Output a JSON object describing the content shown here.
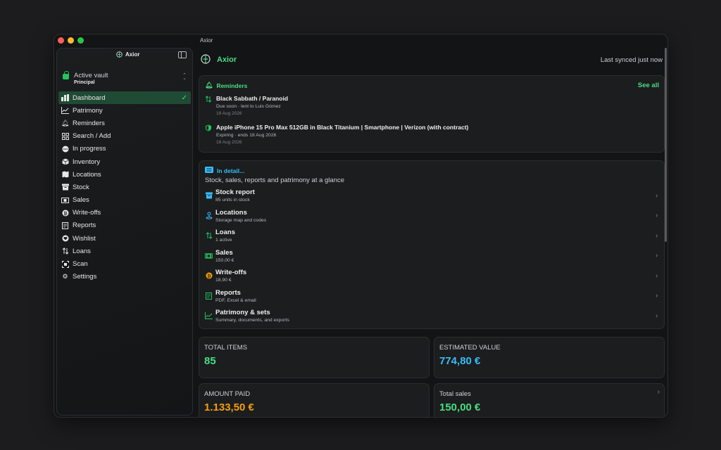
{
  "window": {
    "title": "Axior"
  },
  "sidebar": {
    "brand": "Axior",
    "vault_label": "Active vault",
    "vault_name": "Principal",
    "items": [
      {
        "label": "Dashboard",
        "icon": "bar-chart-icon",
        "active": true
      },
      {
        "label": "Patrimony",
        "icon": "line-chart-icon"
      },
      {
        "label": "Reminders",
        "icon": "bell-icon"
      },
      {
        "label": "Search / Add",
        "icon": "grid-icon"
      },
      {
        "label": "In progress",
        "icon": "ellipsis-circle-icon"
      },
      {
        "label": "Inventory",
        "icon": "cube-icon"
      },
      {
        "label": "Locations",
        "icon": "map-icon"
      },
      {
        "label": "Stock",
        "icon": "archive-box-icon"
      },
      {
        "label": "Sales",
        "icon": "banknote-icon"
      },
      {
        "label": "Write-offs",
        "icon": "coin-icon"
      },
      {
        "label": "Reports",
        "icon": "document-icon"
      },
      {
        "label": "Wishlist",
        "icon": "heart-icon"
      },
      {
        "label": "Loans",
        "icon": "arrows-icon"
      },
      {
        "label": "Scan",
        "icon": "scan-icon"
      },
      {
        "label": "Settings",
        "icon": "gear-icon"
      }
    ]
  },
  "header": {
    "title": "Axior",
    "sync_status": "Last synced just now"
  },
  "reminders": {
    "heading": "Reminders",
    "see_all": "See all",
    "items": [
      {
        "title": "Black Sabbath / Paranoid",
        "subtitle": "Due soon · lent to Luis Gómez",
        "date": "18 Aug 2026",
        "icon": "loan-arrows-icon"
      },
      {
        "title": "Apple iPhone 15 Pro Max 512GB in Black Titanium | Smartphone | Verizon (with contract)",
        "subtitle": "Expiring · ends 18 Aug 2026",
        "date": "18 Aug 2026",
        "icon": "shield-icon"
      }
    ]
  },
  "details": {
    "heading": "In detail...",
    "subtitle": "Stock, sales, reports and patrimony at a glance",
    "rows": [
      {
        "title": "Stock report",
        "subtitle": "85 units in stock",
        "icon": "archive-box-icon",
        "color": "#38bdf8"
      },
      {
        "title": "Locations",
        "subtitle": "Storage map and codes",
        "icon": "location-pin-icon",
        "color": "#38bdf8"
      },
      {
        "title": "Loans",
        "subtitle": "1 active",
        "icon": "loan-arrows-icon",
        "color": "#22c55e"
      },
      {
        "title": "Sales",
        "subtitle": "150,00 €",
        "icon": "banknote-icon",
        "color": "#22c55e"
      },
      {
        "title": "Write-offs",
        "subtitle": "18,90 €",
        "icon": "coin-icon",
        "color": "#f59e0b"
      },
      {
        "title": "Reports",
        "subtitle": "PDF, Excel & email",
        "icon": "document-icon",
        "color": "#22c55e"
      },
      {
        "title": "Patrimony & sets",
        "subtitle": "Summary, documents, and exports",
        "icon": "line-chart-icon",
        "color": "#22c55e"
      }
    ]
  },
  "stats": {
    "total_items": {
      "label": "TOTAL ITEMS",
      "value": "85",
      "color": "#4ade80"
    },
    "estimated_value": {
      "label": "ESTIMATED VALUE",
      "value": "774,80 €",
      "color": "#38bdf8"
    },
    "amount_paid": {
      "label": "AMOUNT PAID",
      "value": "1.133,50 €",
      "color": "#f59e0b"
    },
    "total_sales": {
      "label": "Total sales",
      "value": "150,00 €",
      "color": "#4ade80"
    }
  },
  "colors": {
    "accent": "#4ade80",
    "active_bg": "#1f4a34",
    "info": "#38bdf8",
    "warning": "#f59e0b"
  }
}
